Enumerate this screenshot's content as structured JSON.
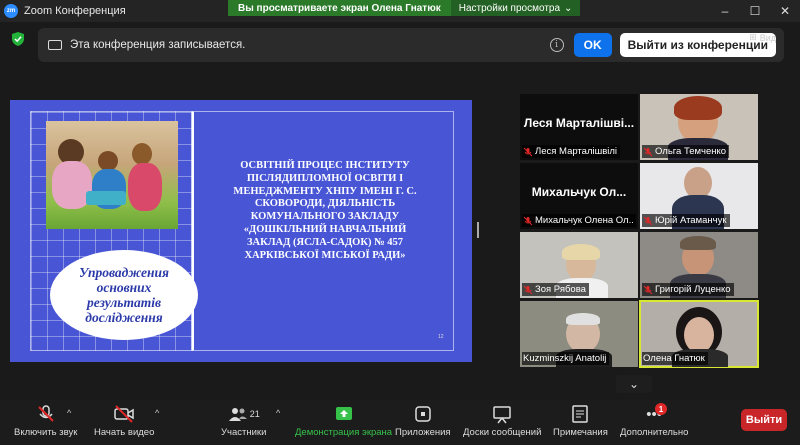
{
  "window": {
    "title": "Zoom Конференция",
    "logo_text": "zm"
  },
  "share_banner": {
    "text": "Вы просматриваете экран Олена Гнатюк",
    "options_label": "Настройки просмотра"
  },
  "recording_bar": {
    "text": "Эта конференция записывается.",
    "info_glyph": "i",
    "ok_label": "OK",
    "leave_label": "Выйти из конференции"
  },
  "view_button": {
    "label": "Вид"
  },
  "slide": {
    "oval_text": "Упроваджения основних результатів дослідження",
    "title": "ОСВІТНІЙ ПРОЦЕС ІНСТИТУТУ ПІСЛЯДИПЛОМНОЇ ОСВІТИ І МЕНЕДЖМЕНТУ ХНПУ ІМЕНІ Г. С. СКОВОРОДИ, ДІЯЛЬНІСТЬ КОМУНАЛЬНОГО ЗАКЛАДУ «ДОШКІЛЬНИЙ НАВЧАЛЬНИЙ ЗАКЛАД (ЯСЛА-САДОК) № 457 ХАРКІВСЬКОЇ МІСЬКОЇ РАДИ»",
    "page_number": "12"
  },
  "participants": [
    {
      "name": "Леся Марталішвілі",
      "big_name": "Леся Марталішві...",
      "video": false
    },
    {
      "name": "Ольга Темченко",
      "big_name": "",
      "video": true
    },
    {
      "name": "Михальчук Олена Ол...",
      "big_name": "Михальчук Ол...",
      "video": false
    },
    {
      "name": "Юрій Атаманчук",
      "big_name": "",
      "video": true
    },
    {
      "name": "Зоя Рябова",
      "big_name": "",
      "video": true
    },
    {
      "name": "Григорій Луценко",
      "big_name": "",
      "video": true
    },
    {
      "name": "Kuzminszkij Anatolij",
      "big_name": "",
      "video": true
    },
    {
      "name": "Олена Гнатюк",
      "big_name": "",
      "video": true,
      "active_speaker": true
    }
  ],
  "toolbar": {
    "mute_label": "Включить звук",
    "video_label": "Начать видео",
    "participants_label": "Участники",
    "participants_count": "21",
    "share_label": "Демонстрация экрана",
    "apps_label": "Приложения",
    "whiteboard_label": "Доски сообщений",
    "annotate_label": "Примечания",
    "more_label": "Дополнительно",
    "more_badge": "1",
    "end_label": "Выйти"
  },
  "colors": {
    "accent": "#0e72ed",
    "share_green": "#36c24a",
    "end_red": "#c9262a",
    "slide_bg": "#4856d6",
    "active_border": "#d8e832"
  }
}
